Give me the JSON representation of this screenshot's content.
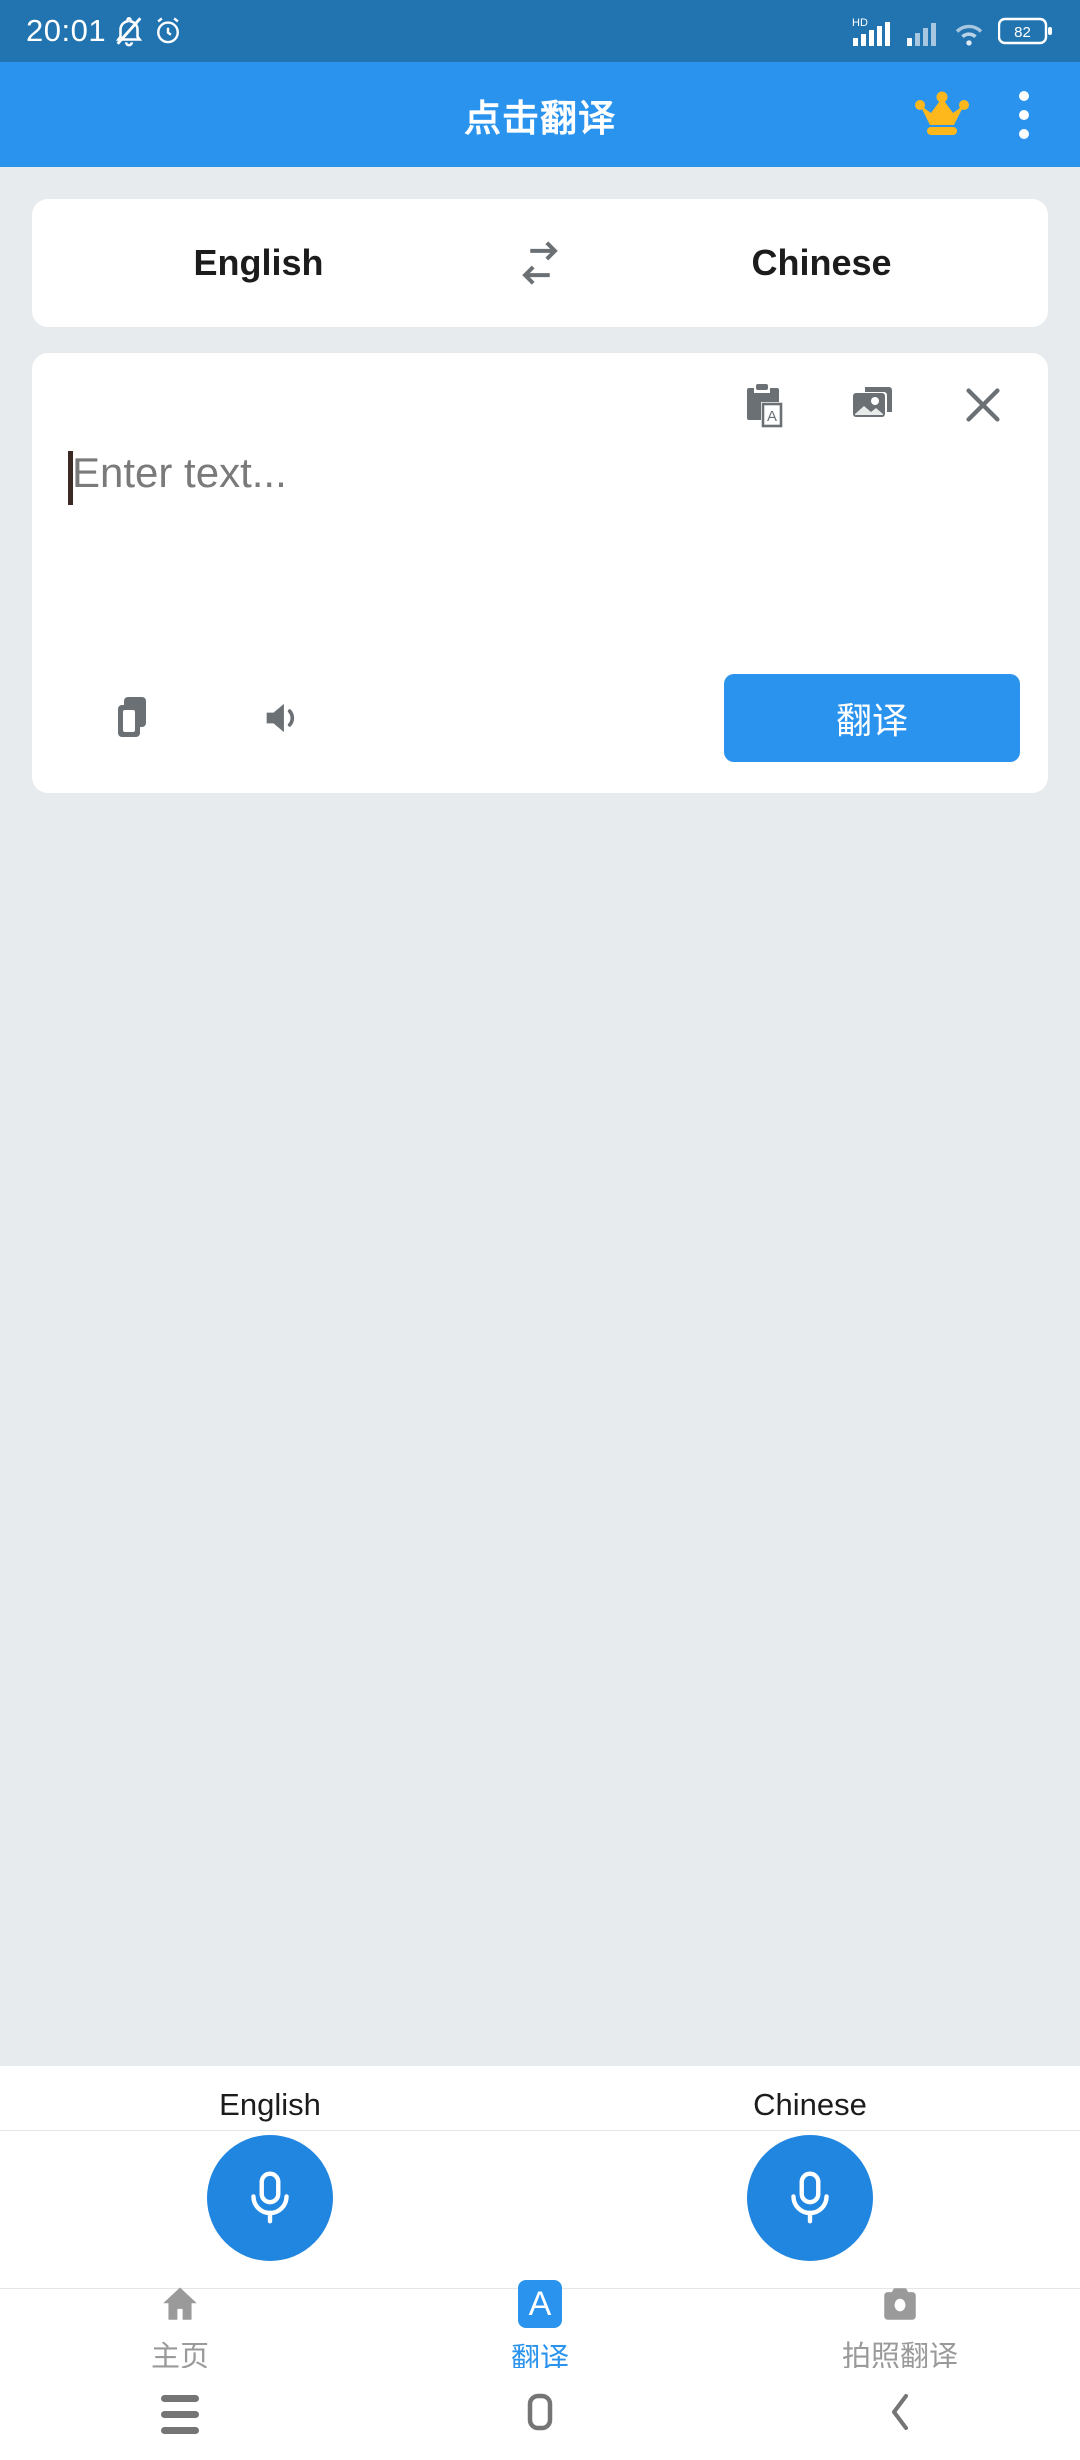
{
  "status_bar": {
    "time": "20:01",
    "battery_percent": "82",
    "icons": [
      "bell-muted-icon",
      "alarm-clock-icon",
      "hd-signal-icon",
      "signal-bars-icon",
      "wifi-icon",
      "battery-icon"
    ],
    "network_label": "HD",
    "background_color": "#2274B0"
  },
  "app_bar": {
    "title": "点击翻译",
    "crown_label": "crown-icon",
    "menu_label": "overflow-menu-icon",
    "background_color": "#2A93EE",
    "crown_color": "#FFB81C"
  },
  "language_selector": {
    "source": "English",
    "target": "Chinese",
    "swap_label": "swap-languages-icon"
  },
  "input_card": {
    "placeholder": "Enter text...",
    "value": "",
    "tools": [
      {
        "name": "paste-icon",
        "label": "paste"
      },
      {
        "name": "gallery-icon",
        "label": "gallery"
      },
      {
        "name": "close-icon",
        "label": "close"
      }
    ],
    "copy_label": "copy-icon",
    "speak_label": "speaker-icon",
    "translate_button": "翻译",
    "translate_button_color": "#2A93EE"
  },
  "mic_panel": {
    "left": {
      "label": "English",
      "icon": "microphone-icon"
    },
    "right": {
      "label": "Chinese",
      "icon": "microphone-icon"
    },
    "button_color": "#2186E0"
  },
  "bottom_nav": {
    "active_color": "#2A93EE",
    "inactive_color": "#9A9A9A",
    "items": [
      {
        "label": "主页",
        "icon": "home-icon",
        "active": false
      },
      {
        "label": "翻译",
        "icon": "translate-a-icon",
        "active": true
      },
      {
        "label": "拍照翻译",
        "icon": "camera-icon",
        "active": false
      }
    ]
  },
  "android_nav": {
    "items": [
      {
        "name": "recents-button",
        "icon": "hamburger-icon"
      },
      {
        "name": "home-button",
        "icon": "rounded-square-icon"
      },
      {
        "name": "back-button",
        "icon": "chevron-left-icon"
      }
    ]
  }
}
